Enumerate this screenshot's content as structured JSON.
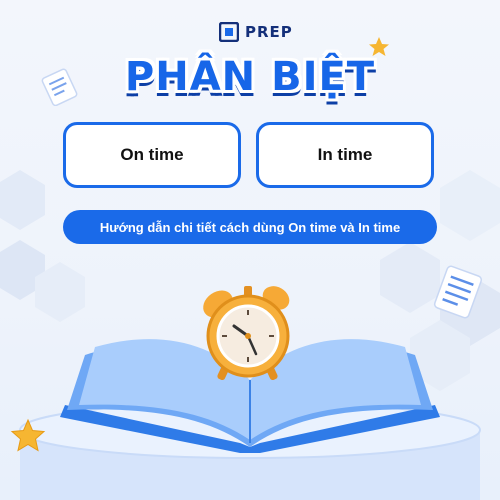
{
  "brand": {
    "name": "PREP",
    "color_primary": "#1a6ae9",
    "color_dark": "#14307a"
  },
  "header": {
    "title": "PHÂN BIỆT"
  },
  "options": [
    {
      "label": "On time"
    },
    {
      "label": "In time"
    }
  ],
  "banner": {
    "text": "Hướng dẫn chi tiết cách dùng On time và In time"
  },
  "decorations": [
    "prep-logo-icon",
    "alarm-clock-illustration",
    "open-book-illustration",
    "star-icon",
    "document-icon",
    "hexagon-pattern",
    "pedestal"
  ]
}
